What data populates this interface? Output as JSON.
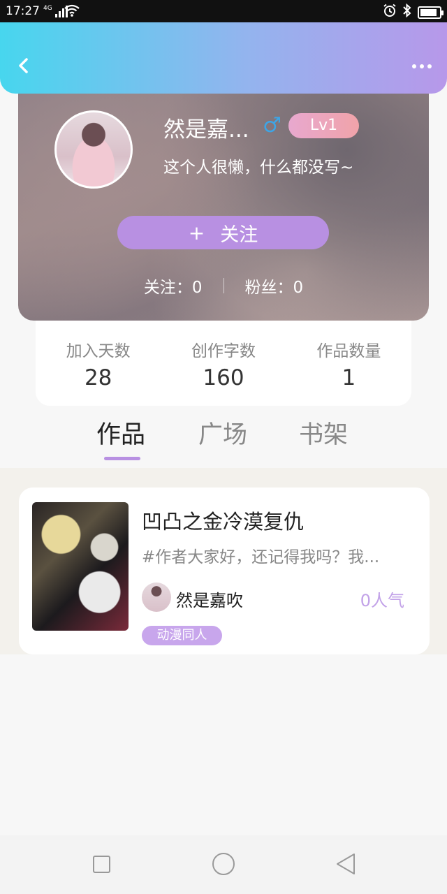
{
  "status_bar": {
    "time": "17:27",
    "network": "4G",
    "battery_level": 0.9,
    "icons": [
      "signal-icon",
      "wifi-icon",
      "alarm-icon",
      "bluetooth-icon",
      "battery-icon"
    ]
  },
  "header": {
    "back_icon": "chevron-left-icon",
    "more_icon": "more-dots-icon",
    "gradient": [
      "#47d6ee",
      "#b798ea"
    ]
  },
  "profile": {
    "nickname": "然是嘉...",
    "gender_symbol": "♂",
    "level": "Lv1",
    "bio": "这个人很懒，什么都没写~",
    "follow_button": {
      "plus": "+",
      "label": "关注"
    },
    "following": "关注：0",
    "followers": "粉丝：0"
  },
  "stats": [
    {
      "label": "加入天数",
      "value": "28"
    },
    {
      "label": "创作字数",
      "value": "160"
    },
    {
      "label": "作品数量",
      "value": "1"
    }
  ],
  "tabs": [
    {
      "label": "作品",
      "active": true
    },
    {
      "label": "广场",
      "active": false
    },
    {
      "label": "书架",
      "active": false
    }
  ],
  "works": [
    {
      "title": "凹凸之金冷漠复仇",
      "description": "#作者大家好，还记得我吗？我...",
      "author": "然是嘉吹",
      "popularity": "0人气",
      "tag": "动漫同人"
    }
  ],
  "colors": {
    "accent": "#b890e2",
    "male": "#3da5e6",
    "popularity": "#c2a2e8"
  },
  "system_nav": [
    "recent-apps-icon",
    "home-icon",
    "back-icon"
  ]
}
